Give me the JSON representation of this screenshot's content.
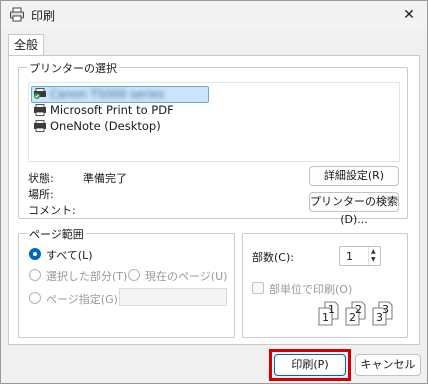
{
  "window": {
    "title": "印刷",
    "close_glyph": "✕"
  },
  "tabs": [
    {
      "label": "全般"
    }
  ],
  "printer_group": {
    "title": "プリンターの選択",
    "printers": [
      {
        "label": "Canon TS000 series",
        "selected": true,
        "obscured": true
      },
      {
        "label": "Microsoft Print to PDF",
        "selected": false
      },
      {
        "label": "OneNote (Desktop)",
        "selected": false
      }
    ],
    "status_label": "状態:",
    "status_value": "準備完了",
    "location_label": "場所:",
    "comment_label": "コメント:",
    "prefs_button": "詳細設定(R)",
    "find_button": "プリンターの検索(D)..."
  },
  "range_group": {
    "title": "ページ範囲",
    "all": "すべて(L)",
    "selection": "選択した部分(T)",
    "current": "現在のページ(U)",
    "pages": "ページ指定(G):",
    "selected_option": "all"
  },
  "copies_group": {
    "copies_label": "部数(C):",
    "copies_value": "1",
    "collate_label": "部単位で印刷(O)",
    "collate_checked": false,
    "collate_pages": [
      "1",
      "1",
      "2",
      "2",
      "3",
      "3"
    ]
  },
  "footer": {
    "print_button": "印刷(P)",
    "cancel_button": "キャンセル"
  },
  "colors": {
    "accent": "#0067c0",
    "highlight": "#d40000",
    "selection": "#cce4f7"
  }
}
